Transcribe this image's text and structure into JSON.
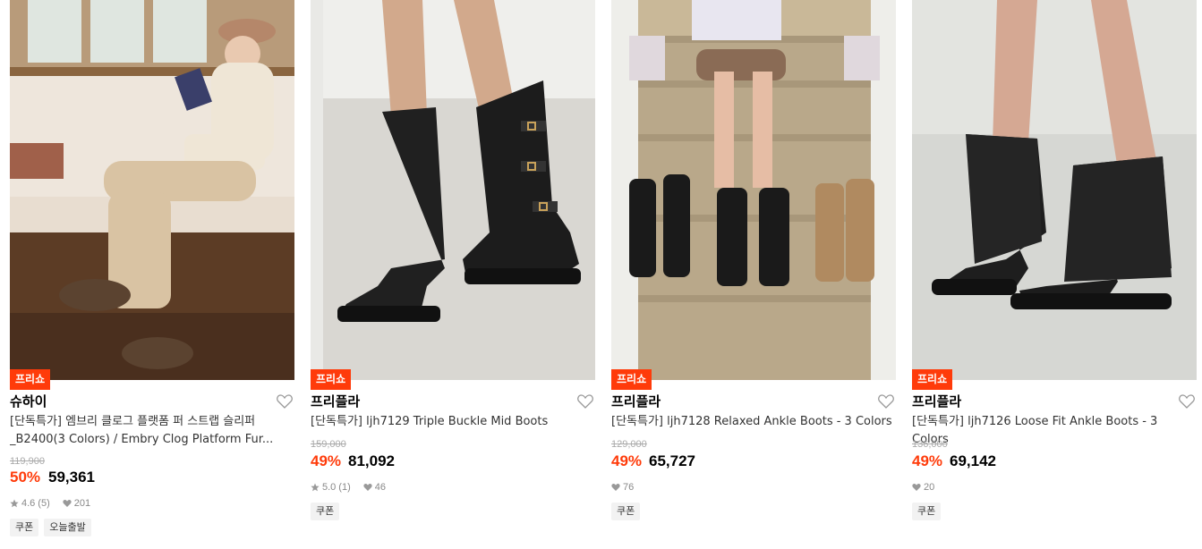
{
  "products": [
    {
      "badge": "프리쇼",
      "brand": "슈하이",
      "name": "[단독특가] 엠브리 클로그 플랫폼 퍼 스트랩 슬리퍼_B2400(3 Colors) / Embry Clog Platform Fur...",
      "original_price": "119,900",
      "discount": "50%",
      "price": "59,361",
      "rating": "4.6",
      "reviews": "(5)",
      "likes": "201",
      "tags": [
        "쿠폰",
        "오늘출발"
      ],
      "image_icon": "photo-woman-reading"
    },
    {
      "badge": "프리쇼",
      "brand": "프리플라",
      "name": "[단독특가] ljh7129 Triple Buckle Mid Boots",
      "original_price": "159,000",
      "discount": "49%",
      "price": "81,092",
      "rating": "5.0",
      "reviews": "(1)",
      "likes": "46",
      "tags": [
        "쿠폰"
      ],
      "image_icon": "photo-buckle-boots"
    },
    {
      "badge": "프리쇼",
      "brand": "프리플라",
      "name": "[단독특가] ljh7128 Relaxed Ankle Boots - 3 Colors",
      "original_price": "129,000",
      "discount": "49%",
      "price": "65,727",
      "likes": "76",
      "tags": [
        "쿠폰"
      ],
      "image_icon": "photo-boots-on-stairs"
    },
    {
      "badge": "프리쇼",
      "brand": "프리플라",
      "name": "[단독특가] ljh7126 Loose Fit Ankle Boots - 3 Colors",
      "original_price": "136,000",
      "discount": "49%",
      "price": "69,142",
      "likes": "20",
      "tags": [
        "쿠폰"
      ],
      "image_icon": "photo-loose-boots"
    }
  ],
  "colors": {
    "accent": "#ff3b0a",
    "strike": "#aaaaaa",
    "meta": "#888888",
    "tag_bg": "#f2f2f2"
  }
}
